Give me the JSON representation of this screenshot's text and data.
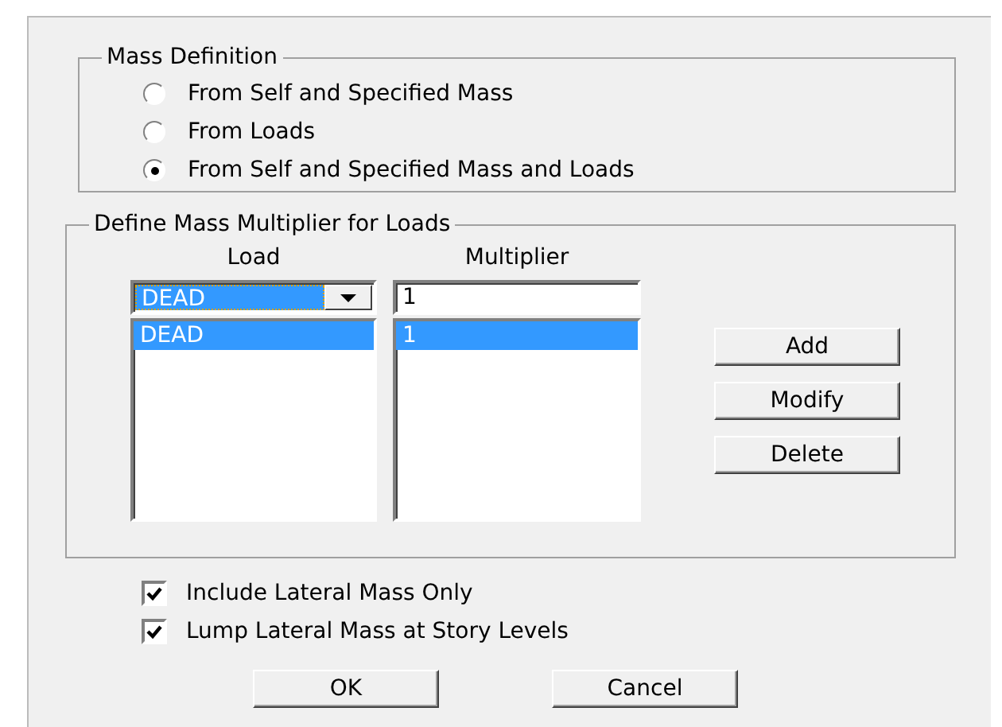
{
  "mass_definition": {
    "title": "Mass Definition",
    "options": [
      {
        "label": "From Self and Specified Mass",
        "selected": false
      },
      {
        "label": "From Loads",
        "selected": false
      },
      {
        "label": "From Self and Specified Mass and Loads",
        "selected": true
      }
    ]
  },
  "multipliers": {
    "title": "Define Mass Multiplier for Loads",
    "load_header": "Load",
    "multiplier_header": "Multiplier",
    "load_combo": {
      "value": "DEAD"
    },
    "multiplier_field": {
      "value": "1"
    },
    "load_list": [
      {
        "label": "DEAD",
        "selected": true
      }
    ],
    "multiplier_list": [
      {
        "label": "1",
        "selected": true
      }
    ],
    "buttons": [
      "Add",
      "Modify",
      "Delete"
    ]
  },
  "checkboxes": [
    {
      "label": "Include Lateral Mass Only",
      "checked": true
    },
    {
      "label": "Lump Lateral Mass at Story Levels",
      "checked": true
    }
  ],
  "buttons": [
    "OK",
    "Cancel"
  ]
}
